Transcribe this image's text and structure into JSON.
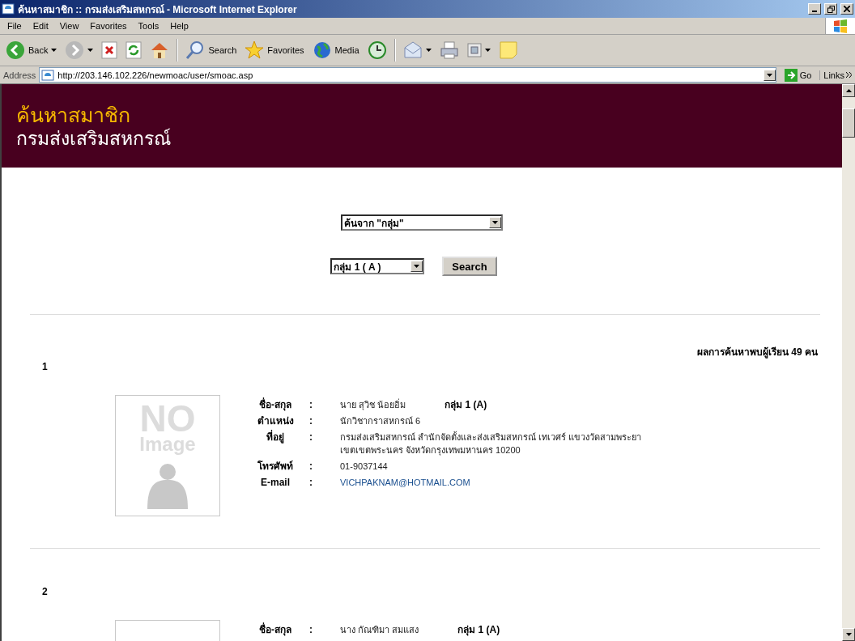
{
  "window": {
    "title": "ค้นหาสมาชิก :: กรมส่งเสริมสหกรณ์ - Microsoft Internet Explorer"
  },
  "menu": [
    "File",
    "Edit",
    "View",
    "Favorites",
    "Tools",
    "Help"
  ],
  "toolbar": [
    {
      "kind": "back",
      "label": "Back",
      "caret": true
    },
    {
      "kind": "forward",
      "caret": true
    },
    {
      "kind": "stop",
      "caret": false
    },
    {
      "kind": "refresh",
      "caret": false
    },
    {
      "kind": "home",
      "caret": false
    },
    {
      "kind": "separator"
    },
    {
      "kind": "search",
      "label": "Search",
      "caret": false
    },
    {
      "kind": "favorites",
      "label": "Favorites",
      "caret": false
    },
    {
      "kind": "media",
      "label": "Media",
      "caret": false
    },
    {
      "kind": "history",
      "caret": false
    },
    {
      "kind": "separator"
    },
    {
      "kind": "mail",
      "caret": true
    },
    {
      "kind": "print",
      "caret": false
    },
    {
      "kind": "edit",
      "caret": true
    },
    {
      "kind": "note",
      "caret": false
    }
  ],
  "address": {
    "label": "Address",
    "url": "http://203.146.102.226/newmoac/user/smoac.asp",
    "go": "Go",
    "links": "Links"
  },
  "banner": {
    "title": "ค้นหาสมาชิก",
    "subtitle": "กรมส่งเสริมสหกรณ์"
  },
  "search": {
    "mode": "ค้นจาก \"กลุ่ม\"",
    "group": "กลุ่ม 1 ( A )",
    "button": "Search"
  },
  "result_count": "ผลการค้นหาพบผู้เรียน 49 คน",
  "records": [
    {
      "number": "1",
      "photo_text": [
        "NO",
        "Image"
      ],
      "fields": [
        {
          "kind": "text",
          "label": "ชื่อ-สกุล",
          "colon": ":",
          "lines": [
            "นาย สุวิช  น้อยอิ่ม"
          ],
          "extra": "กลุ่ม 1 (A)"
        },
        {
          "kind": "text",
          "label": "ตำแหน่ง",
          "colon": ":",
          "lines": [
            "นักวิชากราสหกรณ์ 6"
          ]
        },
        {
          "kind": "text",
          "label": "ที่อยู่",
          "colon": ":",
          "lines": [
            "กรมส่งเสริมสหกรณ์ สำนักจัดตั้งและส่งเสริมสหกรณ์ เทเวศร์ แขวงวัดสามพระยา",
            "เขตเขตพระนคร จังหวัดกรุงเทพมหานคร 10200"
          ]
        },
        {
          "kind": "text",
          "label": "โทรศัพท์",
          "colon": ":",
          "lines": [
            "01-9037144"
          ]
        },
        {
          "kind": "link",
          "label": "E-mail",
          "colon": ":",
          "lines": [
            "VICHPAKNAM@HOTMAIL.COM"
          ]
        }
      ]
    },
    {
      "number": "2",
      "fields": [
        {
          "kind": "text",
          "label": "ชื่อ-สกุล",
          "colon": ":",
          "lines": [
            "นาง กัณฑิมา  สมแสง"
          ],
          "extra": "กลุ่ม 1 (A)"
        }
      ]
    }
  ]
}
